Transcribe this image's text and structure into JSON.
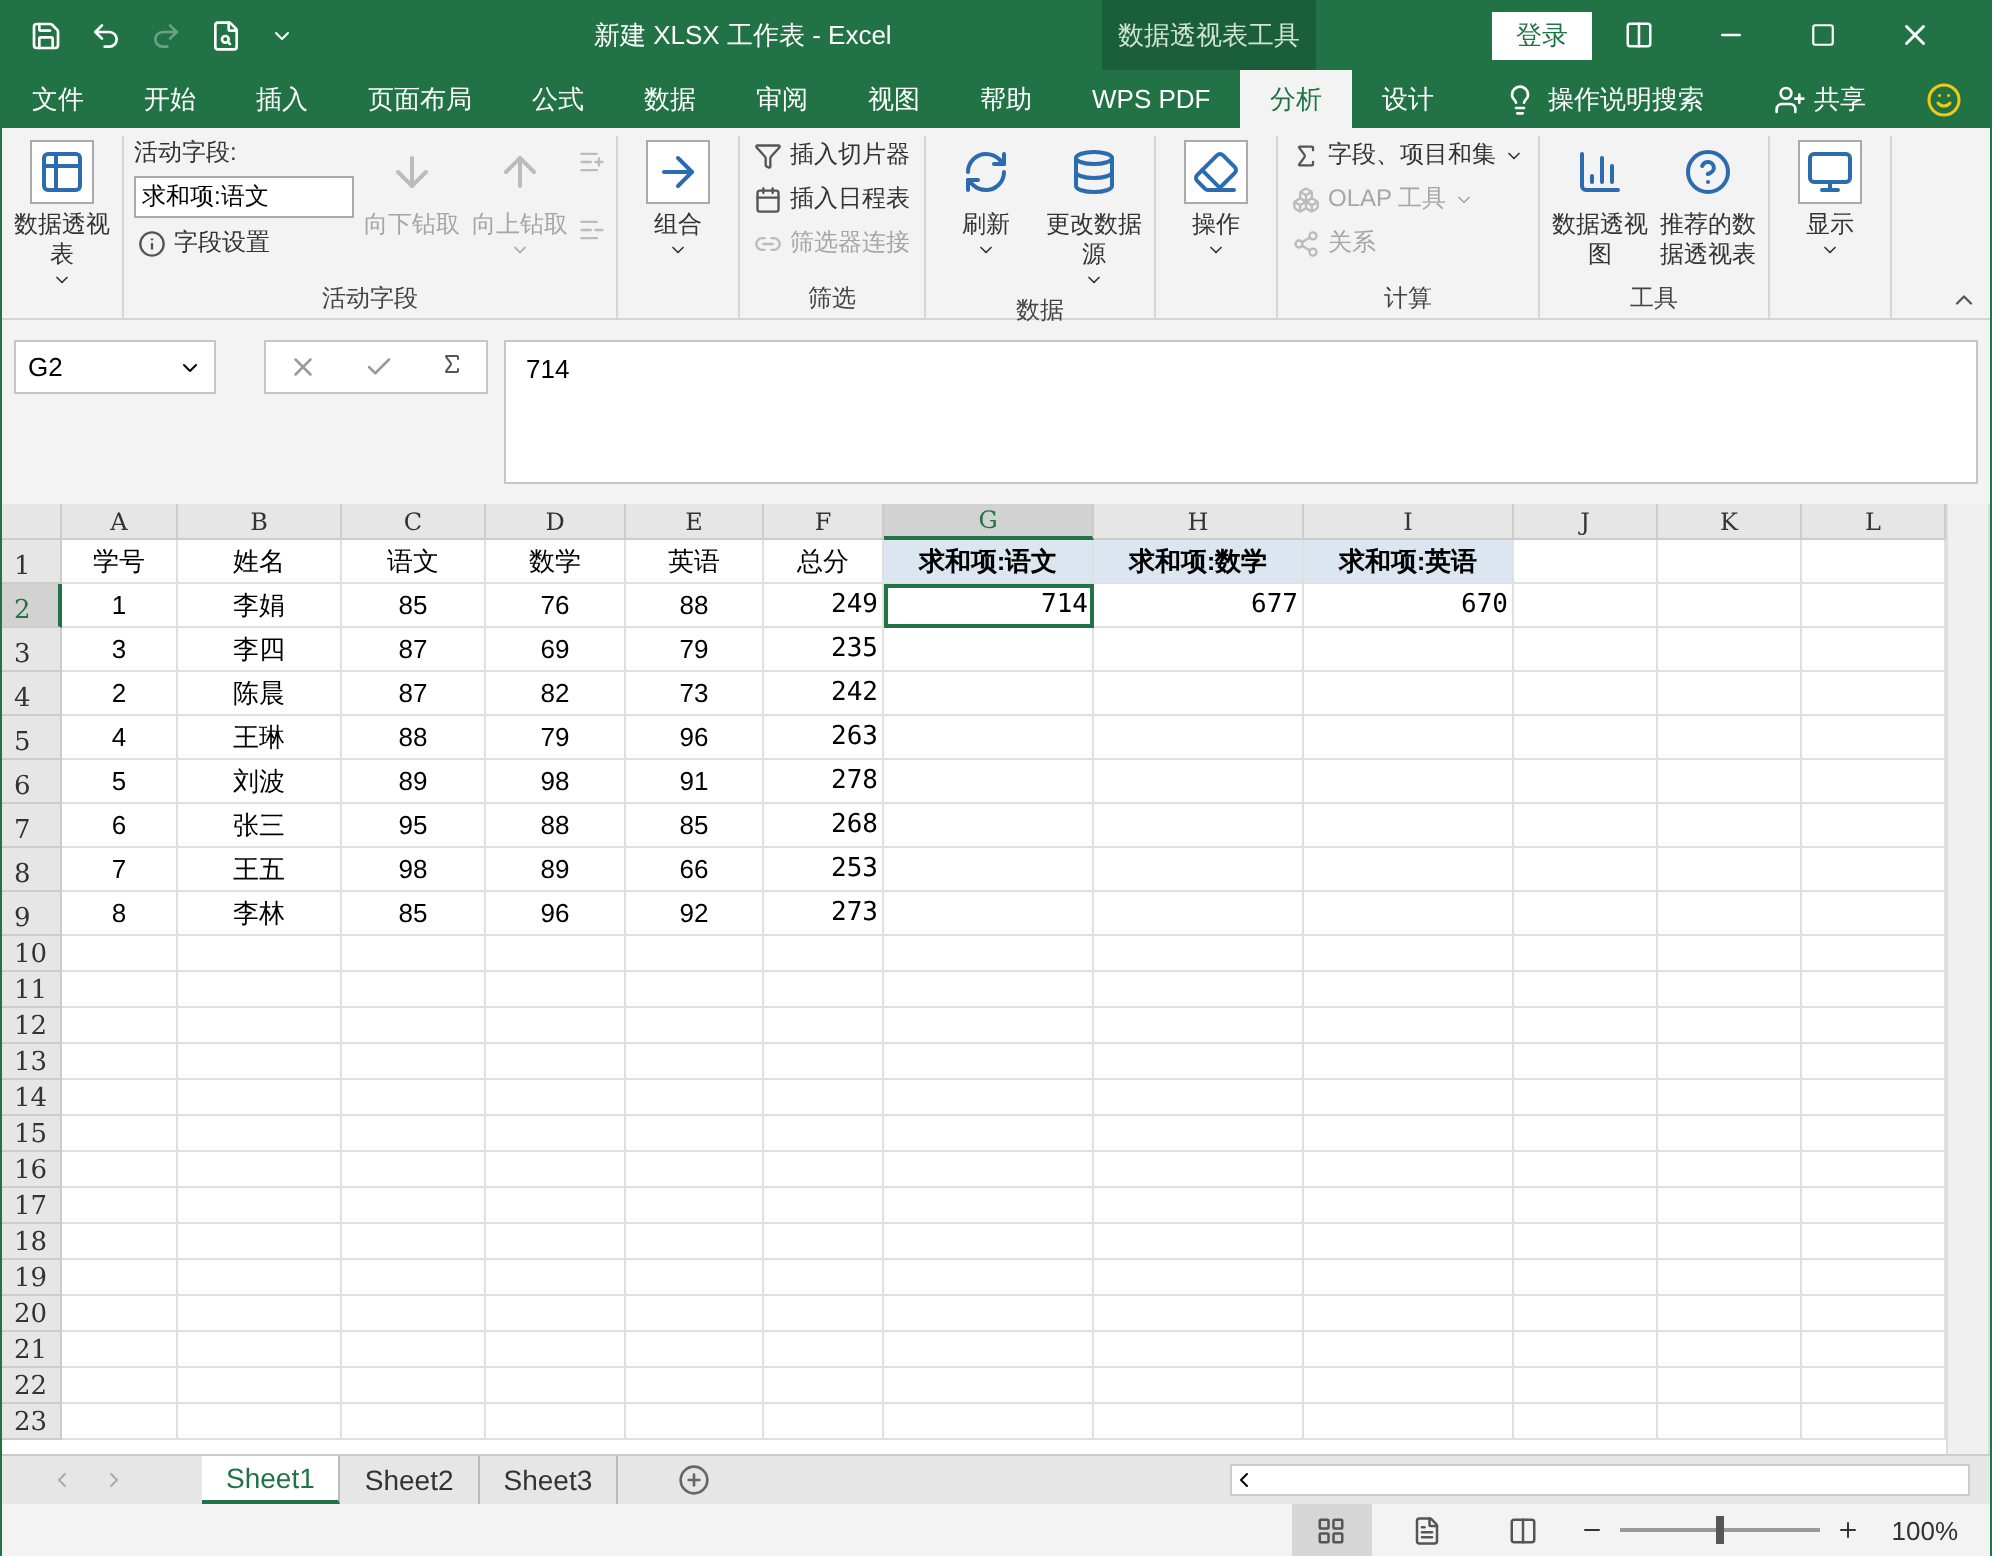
{
  "title_bar": {
    "title": "新建 XLSX 工作表  -  Excel",
    "context_tab": "数据透视表工具",
    "login": "登录"
  },
  "menu_tabs": [
    {
      "label": "文件",
      "selected": false
    },
    {
      "label": "开始",
      "selected": false
    },
    {
      "label": "插入",
      "selected": false
    },
    {
      "label": "页面布局",
      "selected": false
    },
    {
      "label": "公式",
      "selected": false
    },
    {
      "label": "数据",
      "selected": false
    },
    {
      "label": "审阅",
      "selected": false
    },
    {
      "label": "视图",
      "selected": false
    },
    {
      "label": "帮助",
      "selected": false
    },
    {
      "label": "WPS PDF",
      "selected": false
    },
    {
      "label": "分析",
      "selected": true
    },
    {
      "label": "设计",
      "selected": false
    }
  ],
  "help_search": "操作说明搜索",
  "share": "共享",
  "ribbon_groups": [
    {
      "buttons": [
        {
          "kind": "large",
          "label": "数据透视表",
          "disabled": false,
          "dropdown": true
        }
      ]
    },
    {
      "label": "活动字段",
      "buttons": [
        {
          "kind": "field",
          "label": "活动字段:",
          "value": "求和项:语文"
        },
        {
          "kind": "small",
          "label": "字段设置",
          "disabled": false
        },
        {
          "kind": "large",
          "label": "向下钻取",
          "disabled": true
        },
        {
          "kind": "large",
          "label": "向上钻取",
          "disabled": true,
          "dropdown": true
        },
        {
          "kind": "tiny",
          "disabled": true
        }
      ]
    },
    {
      "buttons": [
        {
          "kind": "large",
          "label": "组合",
          "disabled": false,
          "dropdown": true
        }
      ]
    },
    {
      "label": "筛选",
      "buttons": [
        {
          "kind": "small",
          "label": "插入切片器",
          "disabled": false
        },
        {
          "kind": "small",
          "label": "插入日程表",
          "disabled": false
        },
        {
          "kind": "small",
          "label": "筛选器连接",
          "disabled": true
        }
      ]
    },
    {
      "label": "数据",
      "buttons": [
        {
          "kind": "large",
          "label": "刷新",
          "disabled": false,
          "dropdown": true
        },
        {
          "kind": "large",
          "label": "更改数据源",
          "disabled": false,
          "dropdown": true
        }
      ]
    },
    {
      "buttons": [
        {
          "kind": "large",
          "label": "操作",
          "disabled": false,
          "dropdown": true
        }
      ]
    },
    {
      "label": "计算",
      "buttons": [
        {
          "kind": "small",
          "label": "字段、项目和集",
          "disabled": false,
          "dropdown": true
        },
        {
          "kind": "small",
          "label": "OLAP 工具",
          "disabled": true,
          "dropdown": true
        },
        {
          "kind": "small",
          "label": "关系",
          "disabled": true
        }
      ]
    },
    {
      "label": "工具",
      "buttons": [
        {
          "kind": "large",
          "label": "数据透视图",
          "disabled": false
        },
        {
          "kind": "large",
          "label": "推荐的数据透视表",
          "disabled": false
        }
      ]
    },
    {
      "buttons": [
        {
          "kind": "large",
          "label": "显示",
          "disabled": false,
          "dropdown": true
        }
      ]
    }
  ],
  "formula_bar": {
    "name_box": "G2",
    "value": "714"
  },
  "columns": [
    {
      "label": "A",
      "selected": false
    },
    {
      "label": "B",
      "selected": false
    },
    {
      "label": "C",
      "selected": false
    },
    {
      "label": "D",
      "selected": false
    },
    {
      "label": "E",
      "selected": false
    },
    {
      "label": "F",
      "selected": false
    },
    {
      "label": "G",
      "selected": true
    },
    {
      "label": "H",
      "selected": false
    },
    {
      "label": "I",
      "selected": false
    },
    {
      "label": "J",
      "selected": false
    },
    {
      "label": "K",
      "selected": false
    },
    {
      "label": "L",
      "selected": false
    }
  ],
  "rows": [
    {
      "number": "1",
      "selected": false,
      "cells": [
        "学号",
        "姓名",
        "语文",
        "数学",
        "英语",
        "总分",
        "求和项:语文",
        "求和项:数学",
        "求和项:英语"
      ]
    },
    {
      "number": "2",
      "selected": true,
      "cells": [
        "1",
        "李娟",
        "85",
        "76",
        "88",
        "249",
        "714",
        "677",
        "670"
      ]
    },
    {
      "number": "3",
      "selected": false,
      "cells": [
        "3",
        "李四",
        "87",
        "69",
        "79",
        "235"
      ]
    },
    {
      "number": "4",
      "selected": false,
      "cells": [
        "2",
        "陈晨",
        "87",
        "82",
        "73",
        "242"
      ]
    },
    {
      "number": "5",
      "selected": false,
      "cells": [
        "4",
        "王琳",
        "88",
        "79",
        "96",
        "263"
      ]
    },
    {
      "number": "6",
      "selected": false,
      "cells": [
        "5",
        "刘波",
        "89",
        "98",
        "91",
        "278"
      ]
    },
    {
      "number": "7",
      "selected": false,
      "cells": [
        "6",
        "张三",
        "95",
        "88",
        "85",
        "268"
      ]
    },
    {
      "number": "8",
      "selected": false,
      "cells": [
        "7",
        "王五",
        "98",
        "89",
        "66",
        "253"
      ]
    },
    {
      "number": "9",
      "selected": false,
      "cells": [
        "8",
        "李林",
        "85",
        "96",
        "92",
        "273"
      ]
    },
    {
      "number": "10",
      "selected": false
    },
    {
      "number": "11",
      "selected": false
    },
    {
      "number": "12",
      "selected": false
    },
    {
      "number": "13",
      "selected": false
    },
    {
      "number": "14",
      "selected": false
    },
    {
      "number": "15",
      "selected": false
    },
    {
      "number": "16",
      "selected": false
    },
    {
      "number": "17",
      "selected": false
    },
    {
      "number": "18",
      "selected": false
    },
    {
      "number": "19",
      "selected": false
    },
    {
      "number": "20",
      "selected": false
    },
    {
      "number": "21",
      "selected": false
    },
    {
      "number": "22",
      "selected": false
    },
    {
      "number": "23",
      "selected": false
    }
  ],
  "sheet_tabs": [
    {
      "label": "Sheet1",
      "selected": true
    },
    {
      "label": "Sheet2",
      "selected": false
    },
    {
      "label": "Sheet3",
      "selected": false
    }
  ],
  "status_bar": {
    "zoom": "100%",
    "zoom_level": {
      "level": 0.5
    }
  }
}
